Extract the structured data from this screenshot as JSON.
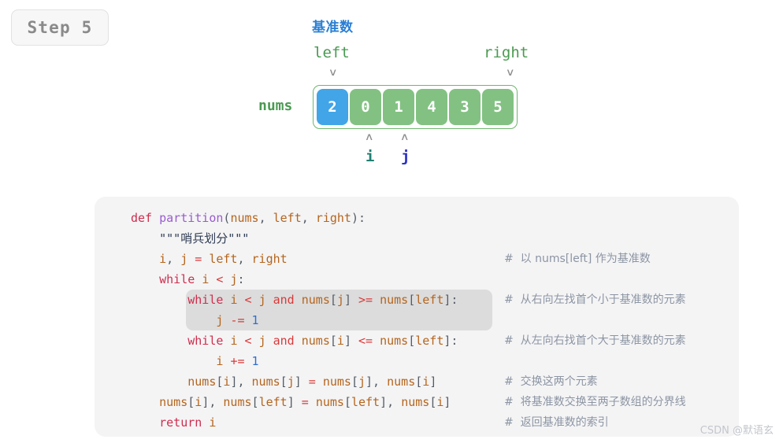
{
  "step_badge": {
    "label": "Step 5"
  },
  "diagram": {
    "pivot_label": "基准数",
    "left_label": "left",
    "right_label": "right",
    "nums_label": "nums",
    "i_label": "i",
    "j_label": "j",
    "arrow_down_glyph": "∨",
    "arrow_up_glyph": "∧",
    "cells": [
      {
        "value": "2",
        "state": "pivot"
      },
      {
        "value": "0",
        "state": "normal"
      },
      {
        "value": "1",
        "state": "normal"
      },
      {
        "value": "4",
        "state": "normal"
      },
      {
        "value": "3",
        "state": "normal"
      },
      {
        "value": "5",
        "state": "normal"
      }
    ],
    "colors": {
      "pivot_cell": "#42a5e8",
      "normal_cell": "#83c183",
      "container_border": "#6fb56f",
      "pivot_text": "#2a7fd4",
      "pointer_text": "#4a9a52",
      "i_text": "#217f72",
      "j_text": "#2b31c4",
      "arrow": "#8d8d8d"
    }
  },
  "code": {
    "language": "python",
    "highlight_lines": [
      5,
      6
    ],
    "lines": [
      {
        "tokens": [
          {
            "t": "def",
            "c": "kw"
          },
          {
            "t": " ",
            "c": "plain"
          },
          {
            "t": "partition",
            "c": "fn"
          },
          {
            "t": "(",
            "c": "punc"
          },
          {
            "t": "nums",
            "c": "name"
          },
          {
            "t": ", ",
            "c": "punc"
          },
          {
            "t": "left",
            "c": "name"
          },
          {
            "t": ", ",
            "c": "punc"
          },
          {
            "t": "right",
            "c": "name"
          },
          {
            "t": "):",
            "c": "punc"
          }
        ],
        "comment": ""
      },
      {
        "tokens": [
          {
            "t": "    \"\"\"哨兵划分\"\"\"",
            "c": "str"
          }
        ],
        "comment": ""
      },
      {
        "tokens": [
          {
            "t": "    ",
            "c": "plain"
          },
          {
            "t": "i",
            "c": "name"
          },
          {
            "t": ", ",
            "c": "punc"
          },
          {
            "t": "j",
            "c": "name"
          },
          {
            "t": " ",
            "c": "plain"
          },
          {
            "t": "=",
            "c": "op"
          },
          {
            "t": " ",
            "c": "plain"
          },
          {
            "t": "left",
            "c": "name"
          },
          {
            "t": ", ",
            "c": "punc"
          },
          {
            "t": "right",
            "c": "name"
          }
        ],
        "comment": "#  以 nums[left] 作为基准数"
      },
      {
        "tokens": [
          {
            "t": "    ",
            "c": "plain"
          },
          {
            "t": "while",
            "c": "kw"
          },
          {
            "t": " ",
            "c": "plain"
          },
          {
            "t": "i",
            "c": "name"
          },
          {
            "t": " ",
            "c": "plain"
          },
          {
            "t": "<",
            "c": "op"
          },
          {
            "t": " ",
            "c": "plain"
          },
          {
            "t": "j",
            "c": "name"
          },
          {
            "t": ":",
            "c": "punc"
          }
        ],
        "comment": ""
      },
      {
        "tokens": [
          {
            "t": "        ",
            "c": "plain"
          },
          {
            "t": "while",
            "c": "kw"
          },
          {
            "t": " ",
            "c": "plain"
          },
          {
            "t": "i",
            "c": "name"
          },
          {
            "t": " ",
            "c": "plain"
          },
          {
            "t": "<",
            "c": "op"
          },
          {
            "t": " ",
            "c": "plain"
          },
          {
            "t": "j",
            "c": "name"
          },
          {
            "t": " ",
            "c": "plain"
          },
          {
            "t": "and",
            "c": "op"
          },
          {
            "t": " ",
            "c": "plain"
          },
          {
            "t": "nums",
            "c": "name"
          },
          {
            "t": "[",
            "c": "punc"
          },
          {
            "t": "j",
            "c": "name"
          },
          {
            "t": "]",
            "c": "punc"
          },
          {
            "t": " ",
            "c": "plain"
          },
          {
            "t": ">=",
            "c": "op"
          },
          {
            "t": " ",
            "c": "plain"
          },
          {
            "t": "nums",
            "c": "name"
          },
          {
            "t": "[",
            "c": "punc"
          },
          {
            "t": "left",
            "c": "name"
          },
          {
            "t": "]:",
            "c": "punc"
          }
        ],
        "comment": "#  从右向左找首个小于基准数的元素"
      },
      {
        "tokens": [
          {
            "t": "            ",
            "c": "plain"
          },
          {
            "t": "j",
            "c": "name"
          },
          {
            "t": " ",
            "c": "plain"
          },
          {
            "t": "-=",
            "c": "op"
          },
          {
            "t": " ",
            "c": "plain"
          },
          {
            "t": "1",
            "c": "num"
          }
        ],
        "comment": ""
      },
      {
        "tokens": [
          {
            "t": "        ",
            "c": "plain"
          },
          {
            "t": "while",
            "c": "kw"
          },
          {
            "t": " ",
            "c": "plain"
          },
          {
            "t": "i",
            "c": "name"
          },
          {
            "t": " ",
            "c": "plain"
          },
          {
            "t": "<",
            "c": "op"
          },
          {
            "t": " ",
            "c": "plain"
          },
          {
            "t": "j",
            "c": "name"
          },
          {
            "t": " ",
            "c": "plain"
          },
          {
            "t": "and",
            "c": "op"
          },
          {
            "t": " ",
            "c": "plain"
          },
          {
            "t": "nums",
            "c": "name"
          },
          {
            "t": "[",
            "c": "punc"
          },
          {
            "t": "i",
            "c": "name"
          },
          {
            "t": "]",
            "c": "punc"
          },
          {
            "t": " ",
            "c": "plain"
          },
          {
            "t": "<=",
            "c": "op"
          },
          {
            "t": " ",
            "c": "plain"
          },
          {
            "t": "nums",
            "c": "name"
          },
          {
            "t": "[",
            "c": "punc"
          },
          {
            "t": "left",
            "c": "name"
          },
          {
            "t": "]:",
            "c": "punc"
          }
        ],
        "comment": "#  从左向右找首个大于基准数的元素"
      },
      {
        "tokens": [
          {
            "t": "            ",
            "c": "plain"
          },
          {
            "t": "i",
            "c": "name"
          },
          {
            "t": " ",
            "c": "plain"
          },
          {
            "t": "+=",
            "c": "op"
          },
          {
            "t": " ",
            "c": "plain"
          },
          {
            "t": "1",
            "c": "num"
          }
        ],
        "comment": ""
      },
      {
        "tokens": [
          {
            "t": "        ",
            "c": "plain"
          },
          {
            "t": "nums",
            "c": "name"
          },
          {
            "t": "[",
            "c": "punc"
          },
          {
            "t": "i",
            "c": "name"
          },
          {
            "t": "], ",
            "c": "punc"
          },
          {
            "t": "nums",
            "c": "name"
          },
          {
            "t": "[",
            "c": "punc"
          },
          {
            "t": "j",
            "c": "name"
          },
          {
            "t": "]",
            "c": "punc"
          },
          {
            "t": " ",
            "c": "plain"
          },
          {
            "t": "=",
            "c": "op"
          },
          {
            "t": " ",
            "c": "plain"
          },
          {
            "t": "nums",
            "c": "name"
          },
          {
            "t": "[",
            "c": "punc"
          },
          {
            "t": "j",
            "c": "name"
          },
          {
            "t": "], ",
            "c": "punc"
          },
          {
            "t": "nums",
            "c": "name"
          },
          {
            "t": "[",
            "c": "punc"
          },
          {
            "t": "i",
            "c": "name"
          },
          {
            "t": "]",
            "c": "punc"
          }
        ],
        "comment": "#  交换这两个元素"
      },
      {
        "tokens": [
          {
            "t": "    ",
            "c": "plain"
          },
          {
            "t": "nums",
            "c": "name"
          },
          {
            "t": "[",
            "c": "punc"
          },
          {
            "t": "i",
            "c": "name"
          },
          {
            "t": "], ",
            "c": "punc"
          },
          {
            "t": "nums",
            "c": "name"
          },
          {
            "t": "[",
            "c": "punc"
          },
          {
            "t": "left",
            "c": "name"
          },
          {
            "t": "]",
            "c": "punc"
          },
          {
            "t": " ",
            "c": "plain"
          },
          {
            "t": "=",
            "c": "op"
          },
          {
            "t": " ",
            "c": "plain"
          },
          {
            "t": "nums",
            "c": "name"
          },
          {
            "t": "[",
            "c": "punc"
          },
          {
            "t": "left",
            "c": "name"
          },
          {
            "t": "], ",
            "c": "punc"
          },
          {
            "t": "nums",
            "c": "name"
          },
          {
            "t": "[",
            "c": "punc"
          },
          {
            "t": "i",
            "c": "name"
          },
          {
            "t": "]",
            "c": "punc"
          }
        ],
        "comment": "#  将基准数交换至两子数组的分界线"
      },
      {
        "tokens": [
          {
            "t": "    ",
            "c": "plain"
          },
          {
            "t": "return",
            "c": "kw"
          },
          {
            "t": " ",
            "c": "plain"
          },
          {
            "t": "i",
            "c": "name"
          }
        ],
        "comment": "#  返回基准数的索引"
      }
    ]
  },
  "watermark": {
    "text": "CSDN @默语玄"
  }
}
